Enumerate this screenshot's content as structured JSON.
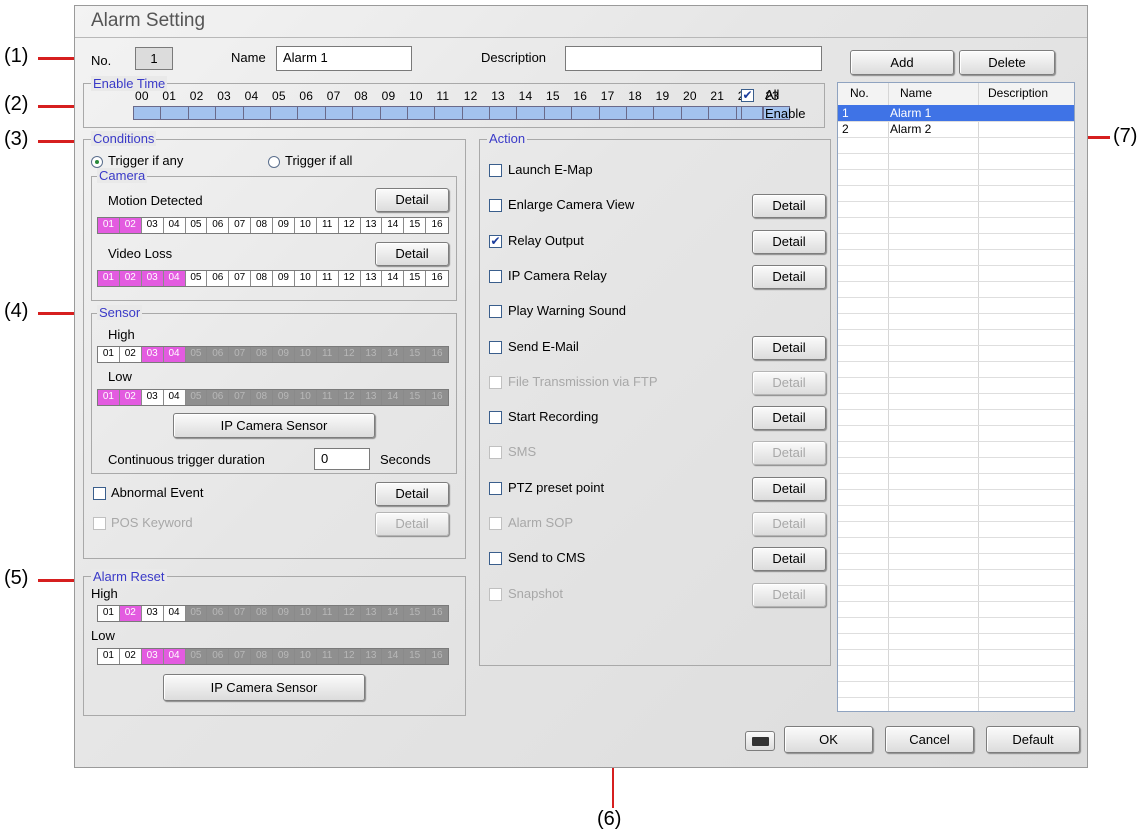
{
  "window": {
    "title": "Alarm Setting"
  },
  "callouts": [
    "(1)",
    "(2)",
    "(3)",
    "(4)",
    "(5)",
    "(6)",
    "(7)"
  ],
  "header": {
    "no_label": "No.",
    "no_value": "1",
    "name_label": "Name",
    "name_value": "Alarm 1",
    "description_label": "Description",
    "description_value": "",
    "add": "Add",
    "delete": "Delete"
  },
  "enable_time": {
    "label": "Enable Time",
    "hours": [
      "00",
      "01",
      "02",
      "03",
      "04",
      "05",
      "06",
      "07",
      "08",
      "09",
      "10",
      "11",
      "12",
      "13",
      "14",
      "15",
      "16",
      "17",
      "18",
      "19",
      "20",
      "21",
      "22",
      "23"
    ],
    "all_label": "All",
    "all_checked": true,
    "enable_label": "Enable"
  },
  "conditions": {
    "label": "Conditions",
    "trigger_any": "Trigger if any",
    "trigger_all": "Trigger if all",
    "selected": "any",
    "camera": {
      "label": "Camera",
      "motion_label": "Motion Detected",
      "motion_channels": [
        "on",
        "on",
        "off",
        "off",
        "off",
        "off",
        "off",
        "off",
        "off",
        "off",
        "off",
        "off",
        "off",
        "off",
        "off",
        "off"
      ],
      "videoloss_label": "Video Loss",
      "videoloss_channels": [
        "on",
        "on",
        "on",
        "on",
        "off",
        "off",
        "off",
        "off",
        "off",
        "off",
        "off",
        "off",
        "off",
        "off",
        "off",
        "off"
      ],
      "detail": "Detail"
    },
    "sensor": {
      "label": "Sensor",
      "high_label": "High",
      "high_channels": [
        "off",
        "off",
        "on",
        "on",
        "dis",
        "dis",
        "dis",
        "dis",
        "dis",
        "dis",
        "dis",
        "dis",
        "dis",
        "dis",
        "dis",
        "dis"
      ],
      "low_label": "Low",
      "low_channels": [
        "on",
        "on",
        "off",
        "off",
        "dis",
        "dis",
        "dis",
        "dis",
        "dis",
        "dis",
        "dis",
        "dis",
        "dis",
        "dis",
        "dis",
        "dis"
      ],
      "ip_camera_sensor": "IP Camera Sensor",
      "duration_label": "Continuous trigger duration",
      "duration_value": "0",
      "seconds": "Seconds"
    },
    "abnormal_event": "Abnormal Event",
    "pos_keyword": "POS Keyword",
    "detail": "Detail"
  },
  "channel_numbers": [
    "01",
    "02",
    "03",
    "04",
    "05",
    "06",
    "07",
    "08",
    "09",
    "10",
    "11",
    "12",
    "13",
    "14",
    "15",
    "16"
  ],
  "alarm_reset": {
    "label": "Alarm Reset",
    "high_label": "High",
    "high_channels": [
      "off",
      "on",
      "off",
      "off",
      "dis",
      "dis",
      "dis",
      "dis",
      "dis",
      "dis",
      "dis",
      "dis",
      "dis",
      "dis",
      "dis",
      "dis"
    ],
    "low_label": "Low",
    "low_channels": [
      "off",
      "off",
      "on",
      "on",
      "dis",
      "dis",
      "dis",
      "dis",
      "dis",
      "dis",
      "dis",
      "dis",
      "dis",
      "dis",
      "dis",
      "dis"
    ],
    "ip_camera_sensor": "IP Camera Sensor"
  },
  "action": {
    "label": "Action",
    "detail": "Detail",
    "items": [
      {
        "label": "Launch E-Map",
        "checked": false,
        "disabled": false,
        "has_detail": false
      },
      {
        "label": "Enlarge Camera View",
        "checked": false,
        "disabled": false,
        "has_detail": true
      },
      {
        "label": "Relay Output",
        "checked": true,
        "disabled": false,
        "has_detail": true
      },
      {
        "label": "IP Camera Relay",
        "checked": false,
        "disabled": false,
        "has_detail": true
      },
      {
        "label": "Play Warning Sound",
        "checked": false,
        "disabled": false,
        "has_detail": false
      },
      {
        "label": "Send E-Mail",
        "checked": false,
        "disabled": false,
        "has_detail": true
      },
      {
        "label": "File Transmission via FTP",
        "checked": false,
        "disabled": true,
        "has_detail": true
      },
      {
        "label": "Start Recording",
        "checked": false,
        "disabled": false,
        "has_detail": true
      },
      {
        "label": "SMS",
        "checked": false,
        "disabled": true,
        "has_detail": true
      },
      {
        "label": "PTZ preset point",
        "checked": false,
        "disabled": false,
        "has_detail": true
      },
      {
        "label": "Alarm SOP",
        "checked": false,
        "disabled": true,
        "has_detail": true
      },
      {
        "label": "Send to CMS",
        "checked": false,
        "disabled": false,
        "has_detail": true
      },
      {
        "label": "Snapshot",
        "checked": false,
        "disabled": true,
        "has_detail": true
      }
    ]
  },
  "alarm_list": {
    "columns": [
      "No.",
      "Name",
      "Description"
    ],
    "rows": [
      {
        "no": "1",
        "name": "Alarm 1",
        "description": "",
        "selected": true
      },
      {
        "no": "2",
        "name": "Alarm 2",
        "description": "",
        "selected": false
      }
    ]
  },
  "footer": {
    "ok": "OK",
    "cancel": "Cancel",
    "default": "Default"
  },
  "colors": {
    "channel_on": "#e35be0",
    "selection": "#3f73e6",
    "group_label": "#3a3ac8",
    "callout_line": "#d61f1f"
  }
}
